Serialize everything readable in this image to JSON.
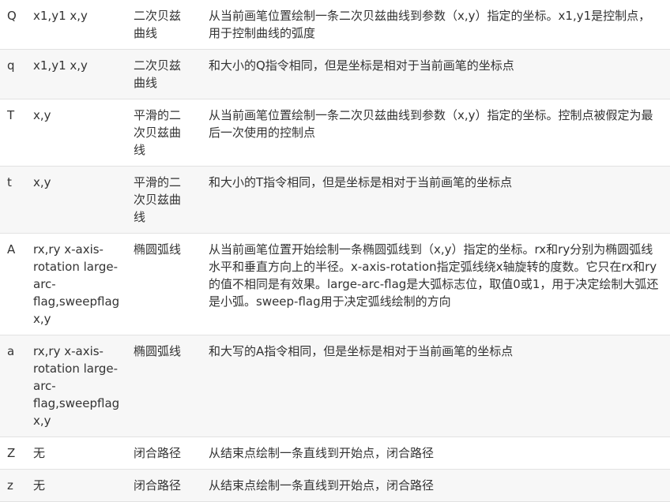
{
  "rows": [
    {
      "command": "Q",
      "params": "x1,y1 x,y",
      "name": "二次贝兹曲线",
      "description": "从当前画笔位置绘制一条二次贝兹曲线到参数（x,y）指定的坐标。x1,y1是控制点，用于控制曲线的弧度"
    },
    {
      "command": "q",
      "params": "x1,y1 x,y",
      "name": "二次贝兹曲线",
      "description": "和大小的Q指令相同，但是坐标是相对于当前画笔的坐标点"
    },
    {
      "command": "T",
      "params": "x,y",
      "name": "平滑的二次贝兹曲线",
      "description": "从当前画笔位置绘制一条二次贝兹曲线到参数（x,y）指定的坐标。控制点被假定为最后一次使用的控制点"
    },
    {
      "command": "t",
      "params": "x,y",
      "name": "平滑的二次贝兹曲线",
      "description": "和大小的T指令相同，但是坐标是相对于当前画笔的坐标点"
    },
    {
      "command": "A",
      "params": "rx,ry x-axis-rotation large-arc-flag,sweepflag x,y",
      "name": "椭圆弧线",
      "description": "从当前画笔位置开始绘制一条椭圆弧线到（x,y）指定的坐标。rx和ry分别为椭圆弧线水平和垂直方向上的半径。x-axis-rotation指定弧线绕x轴旋转的度数。它只在rx和ry的值不相同是有效果。large-arc-flag是大弧标志位，取值0或1，用于决定绘制大弧还是小弧。sweep-flag用于决定弧线绘制的方向"
    },
    {
      "command": "a",
      "params": "rx,ry x-axis-rotation large-arc-flag,sweepflag x,y",
      "name": "椭圆弧线",
      "description": "和大写的A指令相同，但是坐标是相对于当前画笔的坐标点"
    },
    {
      "command": "Z",
      "params": "无",
      "name": "闭合路径",
      "description": "从结束点绘制一条直线到开始点，闭合路径"
    },
    {
      "command": "z",
      "params": "无",
      "name": "闭合路径",
      "description": "从结束点绘制一条直线到开始点，闭合路径"
    }
  ]
}
